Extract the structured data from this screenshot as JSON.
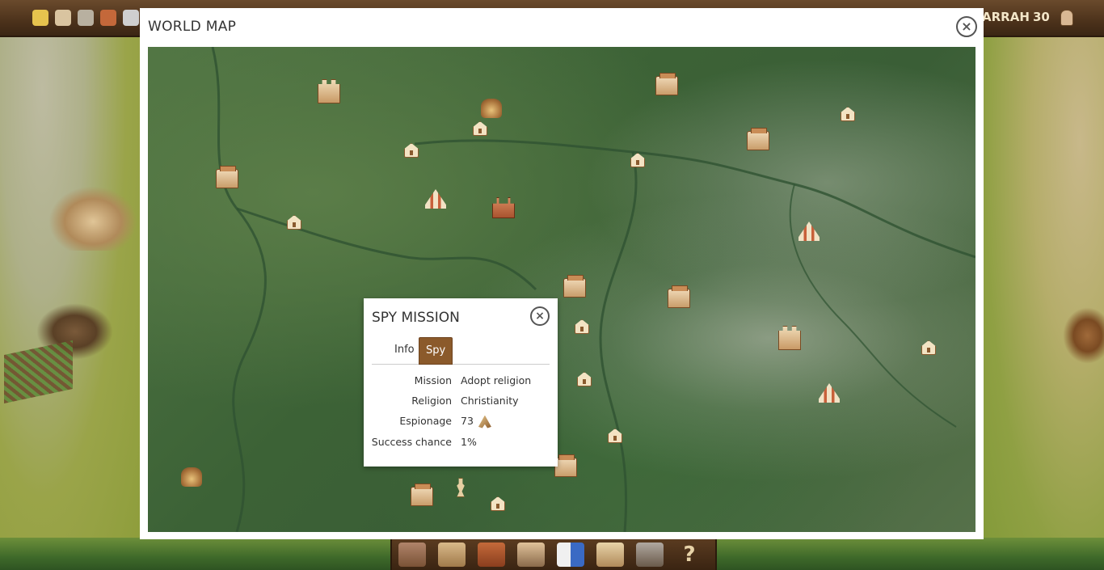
{
  "top_bar": {
    "resources": [
      {
        "icon": "wheat-icon",
        "color": "#e6c34e"
      },
      {
        "icon": "bread-icon",
        "color": "#d9c4a0"
      },
      {
        "icon": "stone-icon",
        "color": "#b8b0a0"
      },
      {
        "icon": "barrel-icon",
        "color": "#c4683a"
      },
      {
        "icon": "tools-icon",
        "color": "#cfcfcf"
      }
    ],
    "player_name_fragment": "ARRAH",
    "player_level": "30",
    "player_icon": "peasant-icon"
  },
  "world_map": {
    "title": "WORLD MAP",
    "close_icon": "close-icon",
    "markers": [
      {
        "type": "castle",
        "icon": "castle-icon"
      },
      {
        "type": "town",
        "icon": "town-icon"
      },
      {
        "type": "camp",
        "icon": "camp-icon"
      },
      {
        "type": "house",
        "icon": "house-icon"
      },
      {
        "type": "tent",
        "icon": "tent-icon"
      },
      {
        "type": "church",
        "icon": "church-icon"
      },
      {
        "type": "statue",
        "icon": "statue-icon"
      }
    ]
  },
  "spy_mission": {
    "title": "SPY MISSION",
    "close_icon": "close-icon",
    "tabs": [
      {
        "label": "Info",
        "active": false
      },
      {
        "label": "Spy",
        "active": true
      }
    ],
    "rows": {
      "mission": {
        "label": "Mission",
        "value": "Adopt religion"
      },
      "religion": {
        "label": "Religion",
        "value": "Christianity"
      },
      "espionage": {
        "label": "Espionage",
        "value": "73",
        "icon": "spy-icon"
      },
      "success": {
        "label": "Success chance",
        "value": "1%"
      }
    }
  },
  "toolbar": {
    "buttons": [
      {
        "icon": "village-icon"
      },
      {
        "icon": "building-icon"
      },
      {
        "icon": "horn-icon"
      },
      {
        "icon": "advisor-icon"
      },
      {
        "icon": "shield-flag-icon"
      },
      {
        "icon": "scroll-icon"
      },
      {
        "icon": "catapult-icon"
      },
      {
        "icon": "help-icon"
      }
    ]
  },
  "colors": {
    "active_tab": "#8b5a2b",
    "top_bar": "#4c321b",
    "map_base": "#3c6236"
  }
}
